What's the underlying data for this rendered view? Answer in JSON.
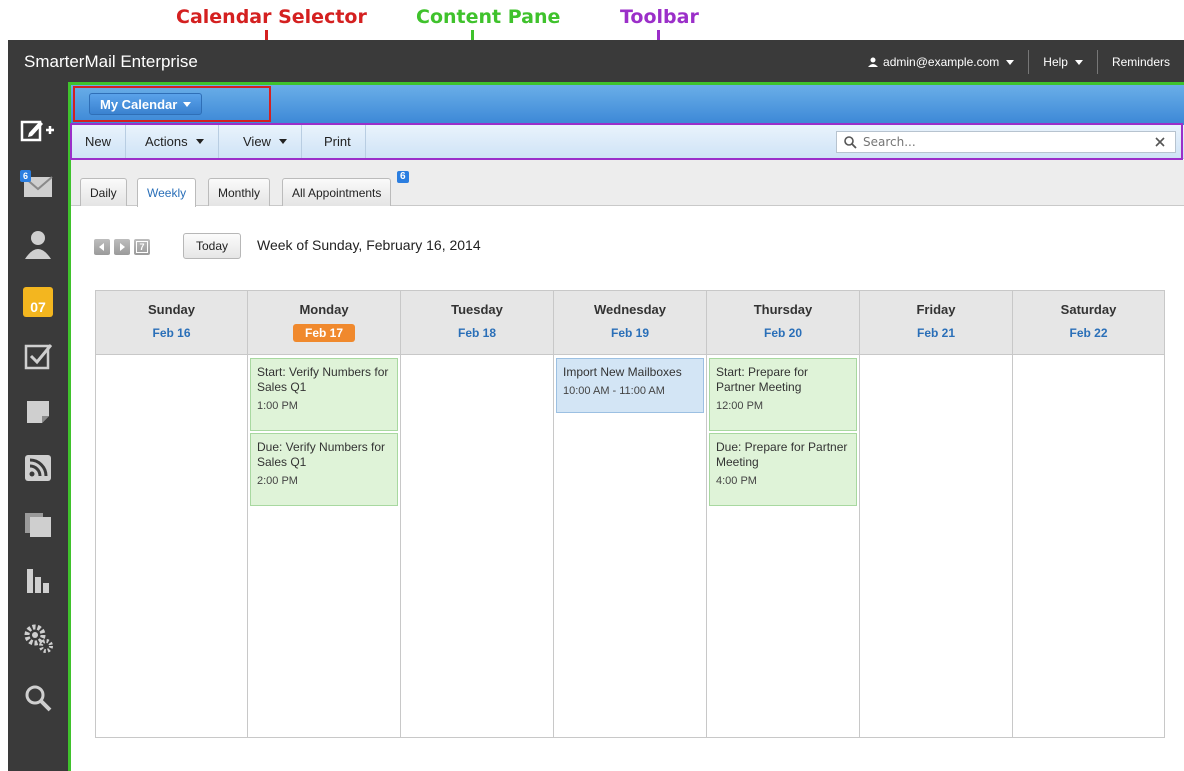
{
  "annotations": {
    "calendar_selector": "Calendar Selector",
    "content_pane": "Content Pane",
    "toolbar": "Toolbar"
  },
  "app": {
    "title": "SmarterMail Enterprise",
    "user": "admin@example.com",
    "help": "Help",
    "reminders": "Reminders"
  },
  "sidebar": {
    "mail_badge": "6",
    "calendar_icon_text": "07"
  },
  "calendar_selector": {
    "label": "My Calendar"
  },
  "toolbar": {
    "new": "New",
    "actions": "Actions",
    "view": "View",
    "print": "Print",
    "search_placeholder": "Search..."
  },
  "tabs": {
    "daily": "Daily",
    "weekly": "Weekly",
    "monthly": "Monthly",
    "all": "All Appointments",
    "all_badge": "6"
  },
  "nav": {
    "today": "Today",
    "week_title": "Week of Sunday, February 16, 2014",
    "calendar_glyph": "7"
  },
  "days": [
    {
      "name": "Sunday",
      "date": "Feb 16"
    },
    {
      "name": "Monday",
      "date": "Feb 17"
    },
    {
      "name": "Tuesday",
      "date": "Feb 18"
    },
    {
      "name": "Wednesday",
      "date": "Feb 19"
    },
    {
      "name": "Thursday",
      "date": "Feb 20"
    },
    {
      "name": "Friday",
      "date": "Feb 21"
    },
    {
      "name": "Saturday",
      "date": "Feb 22"
    }
  ],
  "events": {
    "mon_1": {
      "title": "Start: Verify Numbers for Sales Q1",
      "time": "1:00 PM"
    },
    "mon_2": {
      "title": "Due: Verify Numbers for Sales Q1",
      "time": "2:00 PM"
    },
    "wed_1": {
      "title": "Import New Mailboxes",
      "time": "10:00 AM - 11:00 AM"
    },
    "thu_1": {
      "title": "Start: Prepare for Partner Meeting",
      "time": "12:00 PM"
    },
    "thu_2": {
      "title": "Due: Prepare for Partner Meeting",
      "time": "4:00 PM"
    }
  },
  "colors": {
    "accent_blue": "#3b87d6",
    "today_orange": "#f0892d",
    "annot_red": "#d42020",
    "annot_green": "#3fc22c",
    "annot_purple": "#9b2fc9"
  }
}
